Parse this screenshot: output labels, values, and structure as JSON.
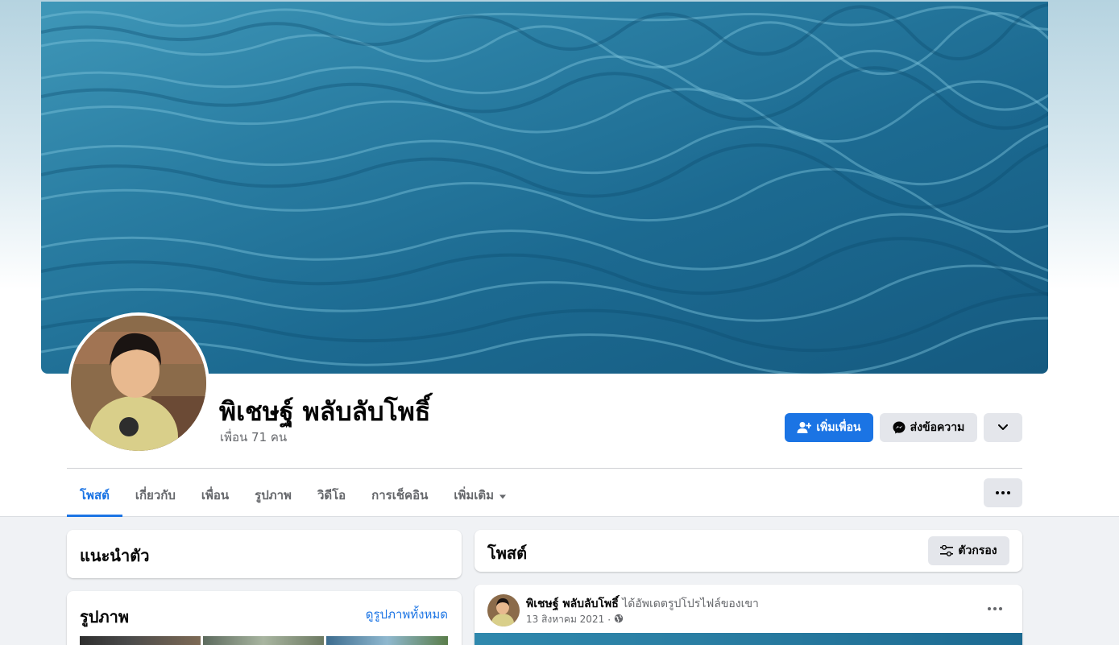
{
  "profile": {
    "name": "พิเชษฐ์ พลับลับโพธิ์",
    "friends": "เพื่อน 71 คน"
  },
  "actions": {
    "add_friend": "เพิ่มเพื่อน",
    "message": "ส่งข้อความ"
  },
  "tabs": [
    {
      "label": "โพสต์",
      "active": true
    },
    {
      "label": "เกี่ยวกับ"
    },
    {
      "label": "เพื่อน"
    },
    {
      "label": "รูปภาพ"
    },
    {
      "label": "วิดีโอ"
    },
    {
      "label": "การเช็คอิน"
    },
    {
      "label": "เพิ่มเติม"
    }
  ],
  "intro": {
    "title": "แนะนำตัว"
  },
  "photos": {
    "title": "รูปภาพ",
    "see_all": "ดูรูปภาพทั้งหมด"
  },
  "posts_header": {
    "title": "โพสต์",
    "filter": "ตัวกรอง"
  },
  "post": {
    "author": "พิเชษฐ์ พลับลับโพธิ์",
    "action": "ได้อัพเดตรูปโปรไฟล์ของเขา",
    "date": "13 สิงหาคม 2021"
  },
  "colors": {
    "accent": "#1b74e4",
    "background": "#f0f2f5"
  },
  "icons": [
    "add-friend-icon",
    "messenger-icon",
    "chevron-down-icon",
    "more-dots-icon",
    "filter-icon",
    "globe-icon",
    "caret-down-icon"
  ]
}
